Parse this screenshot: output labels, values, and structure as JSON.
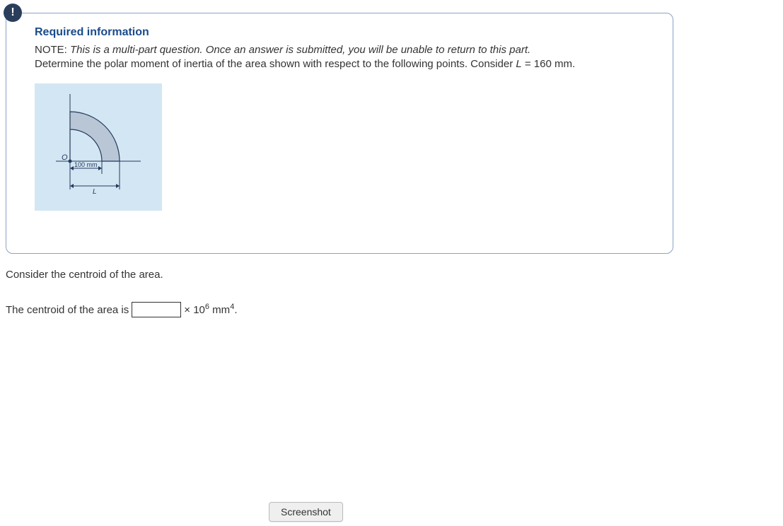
{
  "info_icon_label": "!",
  "card": {
    "title": "Required information",
    "note_prefix": "NOTE: ",
    "note_italic": "This is a multi-part question. Once an answer is submitted, you will be unable to return to this part.",
    "instruction_pre": "Determine the polar moment of inertia of the area shown with respect to the following points. Consider ",
    "l_var": "L",
    "instruction_post": " = 160 mm."
  },
  "figure": {
    "origin_label": "O",
    "inner_dim": "100 mm",
    "outer_dim": "L"
  },
  "below": {
    "prompt": "Consider the centroid of the area.",
    "answer_pre": "The centroid of the area is ",
    "input_value": "",
    "unit_mult": "× 10",
    "unit_exp": "6",
    "unit_mm": " mm",
    "unit_sup4": "4",
    "period": "."
  },
  "screenshot_button": "Screenshot"
}
